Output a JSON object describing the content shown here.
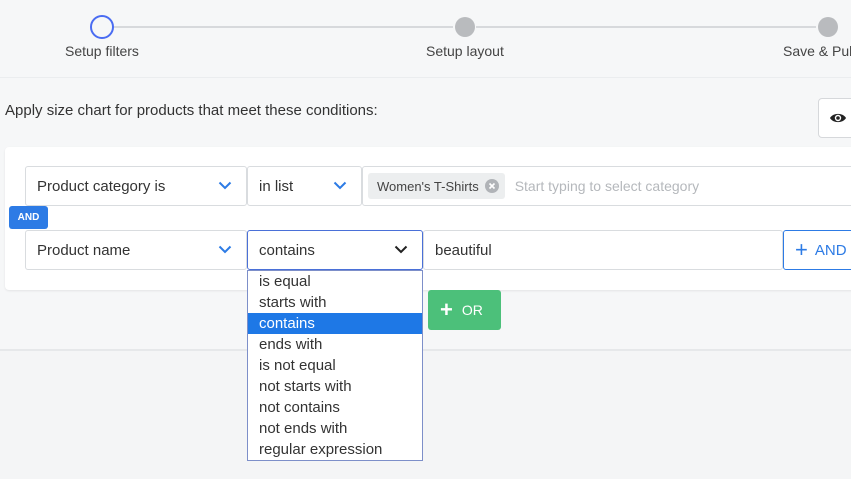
{
  "stepper": {
    "steps": [
      {
        "label": "Setup filters",
        "state": "active"
      },
      {
        "label": "Setup layout",
        "state": "done"
      },
      {
        "label": "Save & Publish",
        "state": "done"
      }
    ],
    "active_color": "#4a6cf2"
  },
  "apply_title": "Apply size chart for products that meet these conditions:",
  "rows": [
    {
      "field": "Product category is",
      "operator": "in list",
      "tags": [
        "Women's T-Shirts"
      ],
      "placeholder": "Start typing to select category"
    },
    {
      "field": "Product name",
      "operator": "contains",
      "value": "beautiful"
    }
  ],
  "connector_label": "AND",
  "and_button_label": "AND",
  "or_button_label": "OR",
  "dropdown": {
    "options": [
      "is equal",
      "starts with",
      "contains",
      "ends with",
      "is not equal",
      "not starts with",
      "not contains",
      "not ends with",
      "regular expression"
    ],
    "selected": "contains"
  },
  "colors": {
    "primary": "#2d7be5",
    "success": "#4cc07a",
    "selected_option": "#1e78e6"
  },
  "icons": {
    "eye": "eye-icon",
    "chevron": "chevron-down-icon",
    "remove_tag": "close-circle-icon",
    "plus": "plus-icon"
  }
}
